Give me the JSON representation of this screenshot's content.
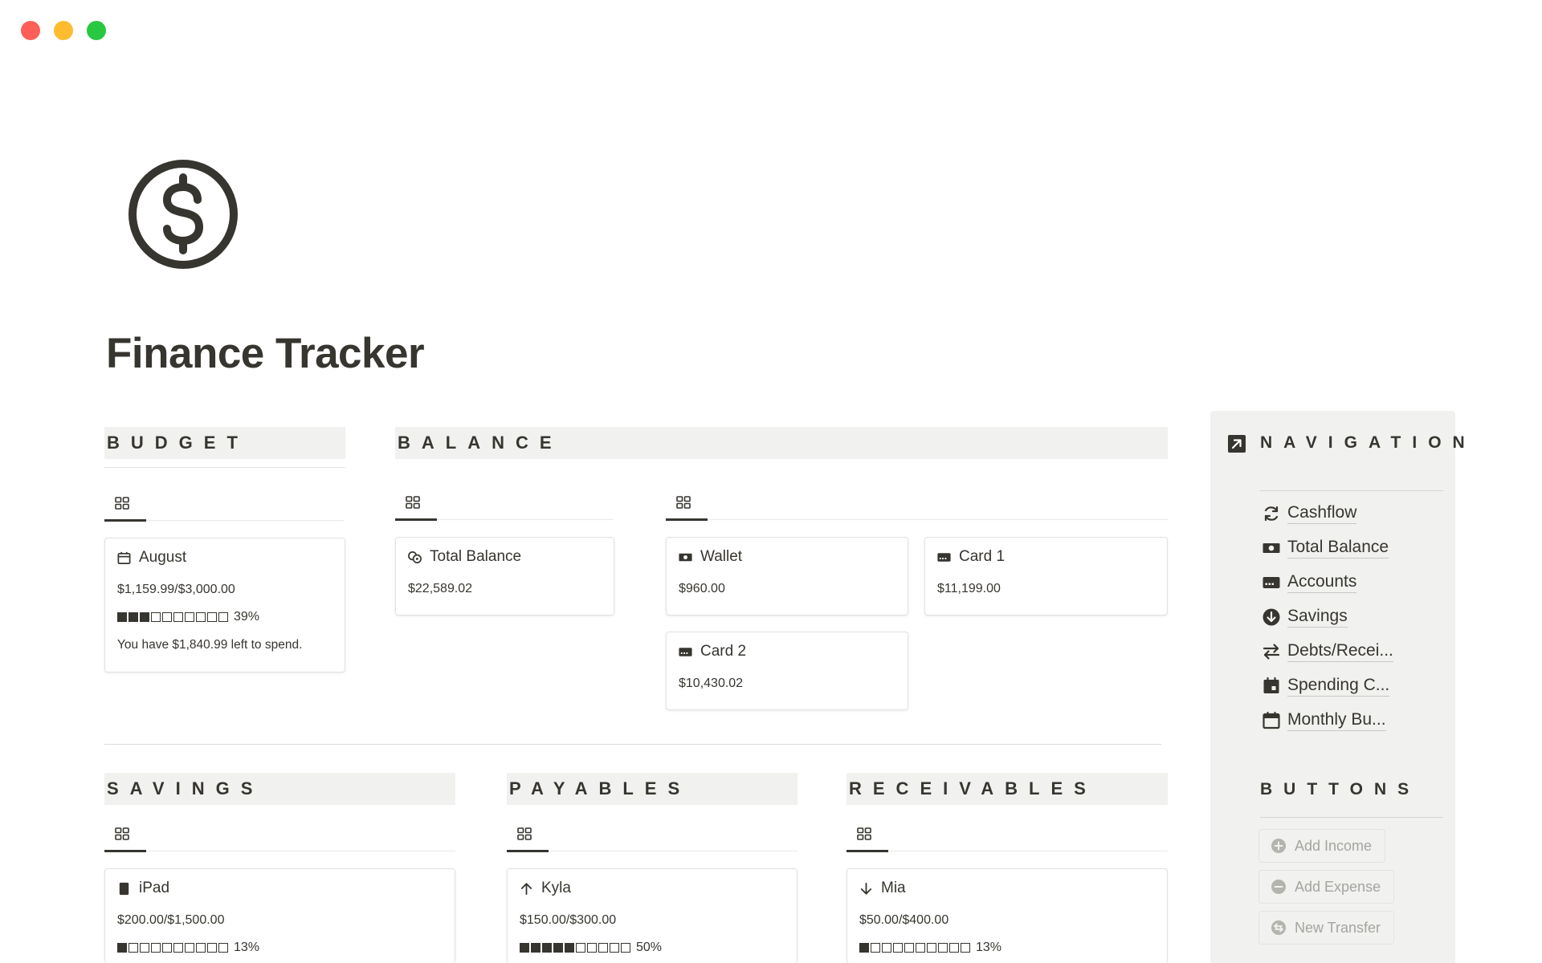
{
  "page": {
    "title": "Finance Tracker",
    "icon": "dollar-circle-icon"
  },
  "budget": {
    "heading": "BUDGET",
    "card": {
      "title": "August",
      "icon": "calendar-icon",
      "amount": "$1,159.99/$3,000.00",
      "progress": 0.39,
      "progress_label": "39%",
      "note": "You have $1,840.99 left to spend."
    }
  },
  "balance": {
    "heading": "BALANCE",
    "total": {
      "title": "Total Balance",
      "icon": "coins-icon",
      "amount": "$22,589.02"
    },
    "wallet": {
      "title": "Wallet",
      "icon": "cash-icon",
      "amount": "$960.00"
    },
    "card1": {
      "title": "Card 1",
      "icon": "credit-card-icon",
      "amount": "$11,199.00"
    },
    "card2": {
      "title": "Card 2",
      "icon": "credit-card-icon",
      "amount": "$10,430.02"
    }
  },
  "savings": {
    "heading": "SAVINGS",
    "card": {
      "title": "iPad",
      "icon": "tablet-icon",
      "amount": "$200.00/$1,500.00",
      "progress": 0.13,
      "progress_label": "13%"
    }
  },
  "payables": {
    "heading": "PAYABLES",
    "card": {
      "title": "Kyla",
      "icon": "arrow-up-icon",
      "amount": "$150.00/$300.00",
      "progress": 0.5,
      "progress_label": "50%"
    }
  },
  "receivables": {
    "heading": "RECEIVABLES",
    "card": {
      "title": "Mia",
      "icon": "arrow-down-icon",
      "amount": "$50.00/$400.00",
      "progress": 0.13,
      "progress_label": "13%"
    }
  },
  "sidebar": {
    "nav_heading": "NAVIGATION",
    "nav_items": [
      {
        "label": "Cashflow",
        "icon": "refresh-icon"
      },
      {
        "label": "Total Balance",
        "icon": "cash-icon"
      },
      {
        "label": "Accounts",
        "icon": "credit-card-icon"
      },
      {
        "label": "Savings",
        "icon": "arrow-down-circle-icon"
      },
      {
        "label": "Debts/Recei...",
        "icon": "swap-arrows-icon"
      },
      {
        "label": "Spending C...",
        "icon": "calendar-filled-icon"
      },
      {
        "label": "Monthly Bu...",
        "icon": "calendar-icon"
      }
    ],
    "buttons_heading": "BUTTONS",
    "buttons": [
      {
        "label": "Add Income",
        "icon": "plus-circle-icon"
      },
      {
        "label": "Add Expense",
        "icon": "minus-circle-icon"
      },
      {
        "label": "New Transfer",
        "icon": "transfer-circle-icon"
      }
    ]
  },
  "colors": {
    "text": "#37352f",
    "header_bg": "#f1f1ef",
    "muted": "#a5a4a0"
  }
}
